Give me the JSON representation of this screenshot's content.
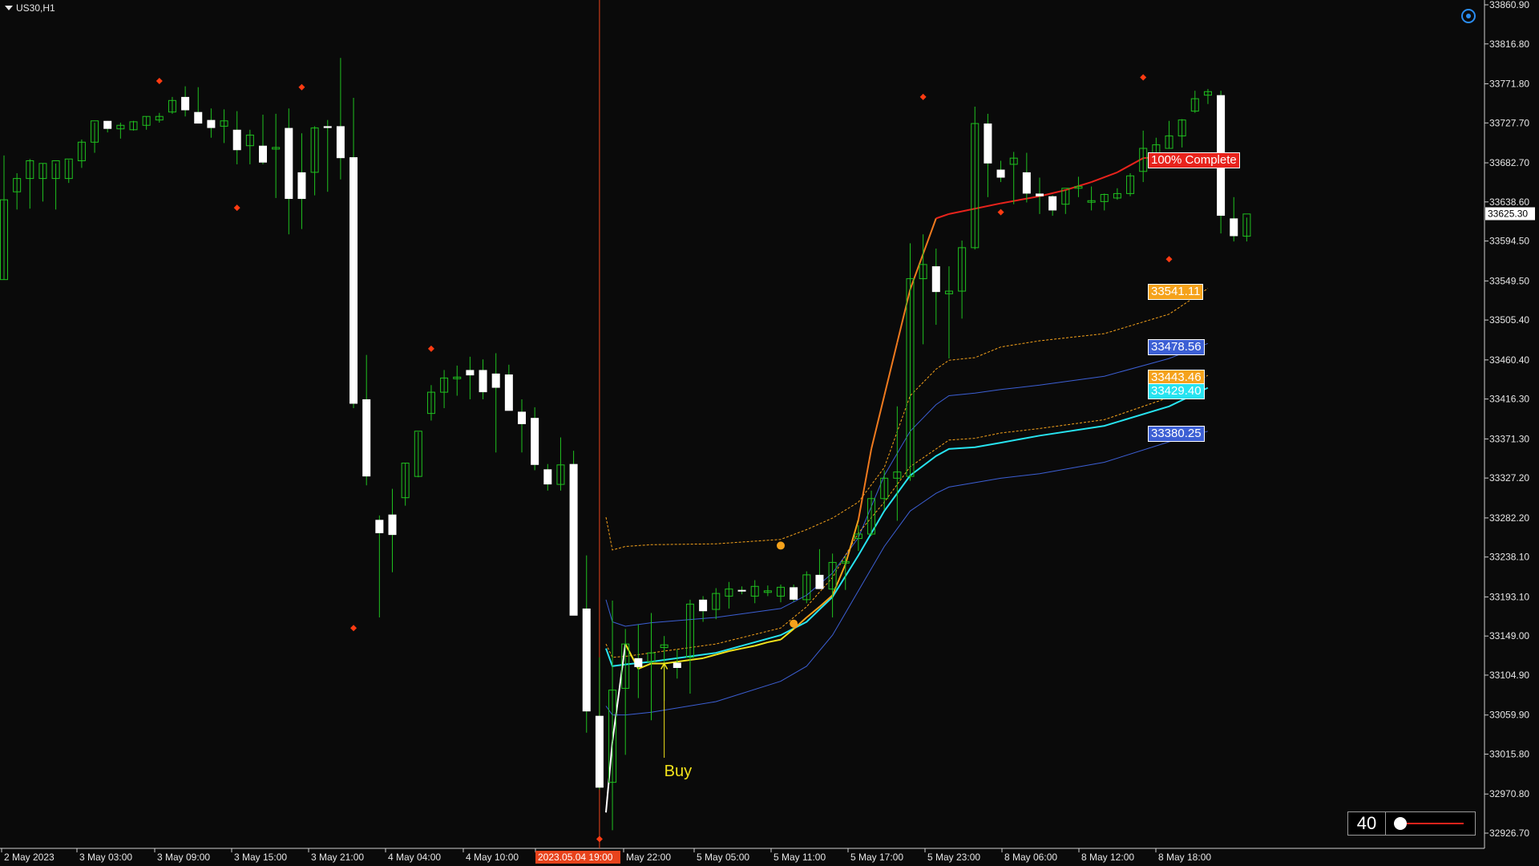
{
  "symbol": {
    "label": "US30,H1"
  },
  "controls": {
    "settings_icon": "target-circle-icon",
    "depth_value": "40"
  },
  "colors": {
    "background": "#0a0a0a",
    "bull_candle": "#1fc01f",
    "bear_candle": "#ffffff",
    "vertical_marker": "#e8431c",
    "orange": "#f5a21b",
    "blue": "#3c5fd4",
    "cyan": "#27e3f0",
    "red": "#e8231c",
    "yellow": "#f2e21b"
  },
  "price_axis": {
    "labels": [
      "33860.90",
      "33816.80",
      "33771.80",
      "33727.70",
      "33682.70",
      "33638.60",
      "33594.50",
      "33549.50",
      "33505.40",
      "33460.40",
      "33416.30",
      "33371.30",
      "33327.20",
      "33282.20",
      "33238.10",
      "33193.10",
      "33149.00",
      "33104.90",
      "33059.90",
      "33015.80",
      "32970.80",
      "32926.70"
    ],
    "current_price": "33625.30"
  },
  "time_axis": {
    "labels": [
      "2 May 2023",
      "3 May 03:00",
      "3 May 09:00",
      "3 May 15:00",
      "3 May 21:00",
      "4 May 04:00",
      "4 May 10:00",
      "2023.05.04 19:00",
      "May 22:00",
      "5 May 05:00",
      "5 May 11:00",
      "5 May 17:00",
      "5 May 23:00",
      "8 May 06:00",
      "8 May 12:00",
      "8 May 18:00"
    ]
  },
  "annotations": {
    "buy_label": "Buy"
  },
  "price_tags": {
    "complete": "100% Complete",
    "orange_upper": "33541.11",
    "blue_upper": "33478.56",
    "orange_mid": "33443.46",
    "cyan_mid": "33429.40",
    "blue_lower": "33380.25"
  },
  "chart_data": {
    "type": "candlestick",
    "title": "US30,H1",
    "x_range": [
      "2 May 2023",
      "8 May 18:00"
    ],
    "y_range": [
      32926.7,
      33860.9
    ],
    "candles": [
      {
        "o": 33551,
        "h": 33691,
        "l": 33551,
        "c": 33641
      },
      {
        "o": 33650,
        "h": 33671,
        "l": 33630,
        "c": 33665
      },
      {
        "o": 33665,
        "h": 33687,
        "l": 33631,
        "c": 33685
      },
      {
        "o": 33665,
        "h": 33682,
        "l": 33639,
        "c": 33682
      },
      {
        "o": 33665,
        "h": 33682,
        "l": 33630,
        "c": 33685
      },
      {
        "o": 33665,
        "h": 33686,
        "l": 33660,
        "c": 33687
      },
      {
        "o": 33685,
        "h": 33709,
        "l": 33677,
        "c": 33706
      },
      {
        "o": 33706,
        "h": 33728,
        "l": 33694,
        "c": 33730
      },
      {
        "o": 33730,
        "h": 33730,
        "l": 33717,
        "c": 33721
      },
      {
        "o": 33721,
        "h": 33728,
        "l": 33710,
        "c": 33725
      },
      {
        "o": 33720,
        "h": 33730,
        "l": 33719,
        "c": 33729
      },
      {
        "o": 33725,
        "h": 33735,
        "l": 33720,
        "c": 33735
      },
      {
        "o": 33731,
        "h": 33739,
        "l": 33728,
        "c": 33735
      },
      {
        "o": 33740,
        "h": 33757,
        "l": 33738,
        "c": 33753
      },
      {
        "o": 33757,
        "h": 33769,
        "l": 33735,
        "c": 33742
      },
      {
        "o": 33740,
        "h": 33768,
        "l": 33728,
        "c": 33727
      },
      {
        "o": 33731,
        "h": 33744,
        "l": 33711,
        "c": 33722
      },
      {
        "o": 33724,
        "h": 33743,
        "l": 33705,
        "c": 33730
      },
      {
        "o": 33720,
        "h": 33741,
        "l": 33681,
        "c": 33697
      },
      {
        "o": 33702,
        "h": 33720,
        "l": 33681,
        "c": 33714
      },
      {
        "o": 33702,
        "h": 33737,
        "l": 33681,
        "c": 33683
      },
      {
        "o": 33700,
        "h": 33738,
        "l": 33643,
        "c": 33700
      },
      {
        "o": 33722,
        "h": 33744,
        "l": 33602,
        "c": 33642
      },
      {
        "o": 33672,
        "h": 33716,
        "l": 33608,
        "c": 33642
      },
      {
        "o": 33672,
        "h": 33724,
        "l": 33646,
        "c": 33722
      },
      {
        "o": 33724,
        "h": 33731,
        "l": 33650,
        "c": 33722
      },
      {
        "o": 33724,
        "h": 33801,
        "l": 33664,
        "c": 33688
      },
      {
        "o": 33689,
        "h": 33756,
        "l": 33406,
        "c": 33411
      },
      {
        "o": 33416,
        "h": 33466,
        "l": 33319,
        "c": 33329
      },
      {
        "o": 33280,
        "h": 33285,
        "l": 33170,
        "c": 33265
      },
      {
        "o": 33286,
        "h": 33315,
        "l": 33221,
        "c": 33263
      },
      {
        "o": 33305,
        "h": 33344,
        "l": 33296,
        "c": 33344
      },
      {
        "o": 33329,
        "h": 33379,
        "l": 33328,
        "c": 33380
      },
      {
        "o": 33400,
        "h": 33432,
        "l": 33392,
        "c": 33424
      },
      {
        "o": 33424,
        "h": 33449,
        "l": 33406,
        "c": 33440
      },
      {
        "o": 33440,
        "h": 33454,
        "l": 33420,
        "c": 33441
      },
      {
        "o": 33449,
        "h": 33464,
        "l": 33416,
        "c": 33443
      },
      {
        "o": 33449,
        "h": 33461,
        "l": 33416,
        "c": 33424
      },
      {
        "o": 33445,
        "h": 33468,
        "l": 33356,
        "c": 33429
      },
      {
        "o": 33444,
        "h": 33455,
        "l": 33406,
        "c": 33403
      },
      {
        "o": 33402,
        "h": 33416,
        "l": 33356,
        "c": 33388
      },
      {
        "o": 33395,
        "h": 33407,
        "l": 33336,
        "c": 33342
      },
      {
        "o": 33337,
        "h": 33343,
        "l": 33313,
        "c": 33320
      },
      {
        "o": 33320,
        "h": 33373,
        "l": 33313,
        "c": 33342
      },
      {
        "o": 33343,
        "h": 33358,
        "l": 33175,
        "c": 33172
      },
      {
        "o": 33180,
        "h": 33240,
        "l": 33040,
        "c": 33064
      },
      {
        "o": 33059,
        "h": 33125,
        "l": 32976,
        "c": 32978
      },
      {
        "o": 32984,
        "h": 33189,
        "l": 32930,
        "c": 33088
      },
      {
        "o": 33090,
        "h": 33157,
        "l": 33015,
        "c": 33140
      },
      {
        "o": 33124,
        "h": 33162,
        "l": 33079,
        "c": 33114
      },
      {
        "o": 33120,
        "h": 33175,
        "l": 33054,
        "c": 33130
      },
      {
        "o": 33136,
        "h": 33149,
        "l": 33076,
        "c": 33139
      },
      {
        "o": 33119,
        "h": 33134,
        "l": 33101,
        "c": 33113
      },
      {
        "o": 33125,
        "h": 33190,
        "l": 33084,
        "c": 33185
      },
      {
        "o": 33190,
        "h": 33194,
        "l": 33165,
        "c": 33177
      },
      {
        "o": 33179,
        "h": 33203,
        "l": 33168,
        "c": 33197
      },
      {
        "o": 33194,
        "h": 33210,
        "l": 33180,
        "c": 33202
      },
      {
        "o": 33201,
        "h": 33205,
        "l": 33196,
        "c": 33200
      },
      {
        "o": 33194,
        "h": 33212,
        "l": 33186,
        "c": 33205
      },
      {
        "o": 33200,
        "h": 33206,
        "l": 33194,
        "c": 33200
      },
      {
        "o": 33194,
        "h": 33207,
        "l": 33187,
        "c": 33204
      },
      {
        "o": 33204,
        "h": 33207,
        "l": 33188,
        "c": 33190
      },
      {
        "o": 33190,
        "h": 33222,
        "l": 33186,
        "c": 33218
      },
      {
        "o": 33218,
        "h": 33247,
        "l": 33206,
        "c": 33202
      },
      {
        "o": 33202,
        "h": 33242,
        "l": 33170,
        "c": 33232
      },
      {
        "o": 33232,
        "h": 33239,
        "l": 33201,
        "c": 33233
      },
      {
        "o": 33259,
        "h": 33274,
        "l": 33245,
        "c": 33264
      },
      {
        "o": 33264,
        "h": 33313,
        "l": 33262,
        "c": 33304
      },
      {
        "o": 33304,
        "h": 33336,
        "l": 33291,
        "c": 33327
      },
      {
        "o": 33327,
        "h": 33408,
        "l": 33279,
        "c": 33334
      },
      {
        "o": 33329,
        "h": 33592,
        "l": 33324,
        "c": 33552
      },
      {
        "o": 33552,
        "h": 33602,
        "l": 33478,
        "c": 33568
      },
      {
        "o": 33566,
        "h": 33586,
        "l": 33500,
        "c": 33537
      },
      {
        "o": 33535,
        "h": 33566,
        "l": 33462,
        "c": 33538
      },
      {
        "o": 33538,
        "h": 33595,
        "l": 33507,
        "c": 33587
      },
      {
        "o": 33587,
        "h": 33746,
        "l": 33585,
        "c": 33727
      },
      {
        "o": 33727,
        "h": 33738,
        "l": 33644,
        "c": 33682
      },
      {
        "o": 33675,
        "h": 33685,
        "l": 33661,
        "c": 33666
      },
      {
        "o": 33681,
        "h": 33695,
        "l": 33636,
        "c": 33688
      },
      {
        "o": 33672,
        "h": 33694,
        "l": 33638,
        "c": 33648
      },
      {
        "o": 33648,
        "h": 33666,
        "l": 33625,
        "c": 33645
      },
      {
        "o": 33645,
        "h": 33646,
        "l": 33623,
        "c": 33629
      },
      {
        "o": 33636,
        "h": 33652,
        "l": 33625,
        "c": 33654
      },
      {
        "o": 33654,
        "h": 33667,
        "l": 33644,
        "c": 33656
      },
      {
        "o": 33640,
        "h": 33656,
        "l": 33629,
        "c": 33640
      },
      {
        "o": 33639,
        "h": 33648,
        "l": 33629,
        "c": 33647
      },
      {
        "o": 33643,
        "h": 33654,
        "l": 33641,
        "c": 33648
      },
      {
        "o": 33648,
        "h": 33671,
        "l": 33645,
        "c": 33668
      },
      {
        "o": 33673,
        "h": 33719,
        "l": 33661,
        "c": 33699
      },
      {
        "o": 33692,
        "h": 33711,
        "l": 33682,
        "c": 33703
      },
      {
        "o": 33699,
        "h": 33730,
        "l": 33699,
        "c": 33713
      },
      {
        "o": 33713,
        "h": 33732,
        "l": 33700,
        "c": 33731
      },
      {
        "o": 33741,
        "h": 33764,
        "l": 33739,
        "c": 33755
      },
      {
        "o": 33759,
        "h": 33766,
        "l": 33749,
        "c": 33763
      },
      {
        "o": 33759,
        "h": 33764,
        "l": 33603,
        "c": 33623
      },
      {
        "o": 33620,
        "h": 33644,
        "l": 33594,
        "c": 33600
      },
      {
        "o": 33600,
        "h": 33621,
        "l": 33594,
        "c": 33625
      }
    ],
    "vertical_marker_bar": 46,
    "buy_bar": 51,
    "swing_markers": [
      {
        "bar": 12,
        "price": 33775,
        "pos": "high"
      },
      {
        "bar": 18,
        "price": 33632,
        "pos": "low"
      },
      {
        "bar": 23,
        "price": 33768,
        "pos": "high"
      },
      {
        "bar": 27,
        "price": 33158,
        "pos": "low"
      },
      {
        "bar": 33,
        "price": 33473,
        "pos": "high"
      },
      {
        "bar": 46,
        "price": 32920,
        "pos": "low"
      },
      {
        "bar": 71,
        "price": 33757,
        "pos": "high"
      },
      {
        "bar": 77,
        "price": 33627,
        "pos": "low"
      },
      {
        "bar": 88,
        "price": 33779,
        "pos": "high"
      },
      {
        "bar": 90,
        "price": 33574,
        "pos": "low"
      }
    ],
    "dots": [
      {
        "bar": 60,
        "price": 33251
      },
      {
        "bar": 61,
        "price": 33163
      }
    ],
    "bands": [
      {
        "name": "orange_upper",
        "style": "dashed",
        "color": "#f5a21b",
        "x": [
          46.5,
          47,
          48,
          50,
          55,
          60,
          62,
          64,
          66,
          68,
          70,
          72,
          73,
          75,
          77,
          80,
          85,
          90,
          93
        ],
        "y": [
          33283,
          33246,
          33250,
          33252,
          33253,
          33258,
          33269,
          33282,
          33300,
          33339,
          33420,
          33450,
          33460,
          33463,
          33475,
          33482,
          33490,
          33512,
          33541
        ]
      },
      {
        "name": "blue_upper",
        "style": "solid",
        "color": "#3c5fd4",
        "x": [
          46.5,
          47,
          48,
          50,
          55,
          60,
          62,
          64,
          66,
          68,
          70,
          72,
          73,
          75,
          77,
          80,
          85,
          90,
          93
        ],
        "y": [
          33190,
          33165,
          33160,
          33164,
          33170,
          33180,
          33195,
          33220,
          33260,
          33330,
          33380,
          33410,
          33420,
          33423,
          33427,
          33432,
          33442,
          33462,
          33479
        ]
      },
      {
        "name": "orange_mid",
        "style": "dashed",
        "color": "#f5a21b",
        "x": [
          46.5,
          47,
          48,
          50,
          55,
          60,
          62,
          64,
          66,
          68,
          70,
          72,
          73,
          75,
          77,
          80,
          85,
          90,
          93
        ],
        "y": [
          33140,
          33125,
          33126,
          33130,
          33140,
          33158,
          33182,
          33215,
          33265,
          33300,
          33340,
          33360,
          33370,
          33372,
          33378,
          33383,
          33393,
          33418,
          33443
        ]
      },
      {
        "name": "cyan_mid",
        "style": "solid",
        "color": "#27e3f0",
        "x": [
          46.5,
          47,
          48,
          50,
          55,
          60,
          62,
          64,
          66,
          68,
          70,
          72,
          73,
          75,
          77,
          80,
          85,
          90,
          93
        ],
        "y": [
          33135,
          33115,
          33117,
          33120,
          33130,
          33150,
          33165,
          33193,
          33240,
          33290,
          33330,
          33352,
          33360,
          33362,
          33367,
          33375,
          33386,
          33408,
          33429
        ]
      },
      {
        "name": "blue_lower",
        "style": "solid",
        "color": "#3c5fd4",
        "x": [
          46.5,
          47,
          48,
          50,
          55,
          60,
          62,
          64,
          66,
          68,
          70,
          72,
          73,
          75,
          77,
          80,
          85,
          90,
          93
        ],
        "y": [
          33070,
          33060,
          33060,
          33063,
          33075,
          33098,
          33115,
          33150,
          33200,
          33250,
          33290,
          33310,
          33317,
          33322,
          33327,
          33332,
          33345,
          33368,
          33380
        ]
      }
    ],
    "trend_line": {
      "x": [
        46.5,
        47,
        48,
        49,
        50,
        51,
        52,
        53,
        54,
        55,
        56,
        57,
        58,
        59,
        60,
        61,
        62,
        63,
        64,
        65,
        66,
        67,
        68,
        69,
        70,
        71,
        72,
        73,
        75,
        77,
        80,
        82,
        84,
        86,
        88,
        90
      ],
      "y": [
        32950,
        33030,
        33140,
        33112,
        33118,
        33118,
        33120,
        33122,
        33124,
        33128,
        33132,
        33135,
        33138,
        33142,
        33145,
        33157,
        33170,
        33182,
        33195,
        33230,
        33280,
        33360,
        33420,
        33480,
        33540,
        33580,
        33620,
        33625,
        33631,
        33637,
        33645,
        33652,
        33661,
        33672,
        33688,
        33690
      ],
      "yellow_until": 61,
      "orange_until": 66,
      "red_after": 72
    }
  }
}
